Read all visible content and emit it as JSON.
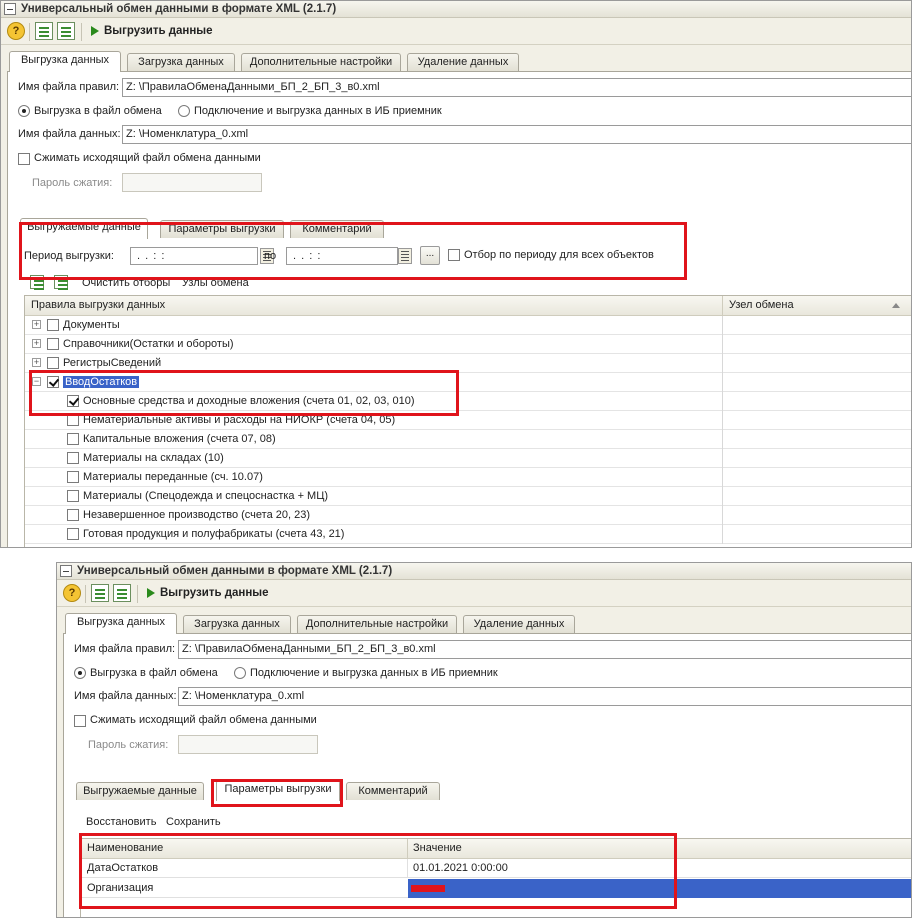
{
  "window_title": "Универсальный обмен данными в формате XML (2.1.7)",
  "toolbar": {
    "run_label": "Выгрузить данные"
  },
  "main_tabs": [
    "Выгрузка данных",
    "Загрузка данных",
    "Дополнительные настройки",
    "Удаление данных"
  ],
  "form": {
    "rules_file_label": "Имя файла правил:",
    "rules_file_value": "Z: \\ПравилаОбменаДанными_БП_2_БП_3_в0.xml",
    "radio_file": "Выгрузка в файл обмена",
    "radio_ib": "Подключение и выгрузка данных в ИБ приемник",
    "data_file_label": "Имя файла данных:",
    "data_file_value": "Z: \\Номенклатура_0.xml",
    "compress_label": "Сжимать исходящий файл обмена данными",
    "password_label": "Пароль сжатия:"
  },
  "sub_tabs": [
    "Выгружаемые данные",
    "Параметры выгрузки",
    "Комментарий"
  ],
  "period": {
    "label": "Период выгрузки:",
    "from_value": ".  .      :  :",
    "to_label": "по",
    "to_value": ".  .      :  :",
    "more_label": "...",
    "filter_all_label": "Отбор по периоду для всех объектов"
  },
  "tree_toolbar": {
    "clear_filters": "Очистить отборы",
    "nodes": "Узлы обмена"
  },
  "tree": {
    "col_rules": "Правила выгрузки данных",
    "col_node": "Узел обмена",
    "rows": [
      {
        "label": "Документы",
        "level": 0
      },
      {
        "label": "Справочники(Остатки и обороты)",
        "level": 0
      },
      {
        "label": "РегистрыСведений",
        "level": 0
      },
      {
        "label": "ВводОстатков",
        "level": 0
      },
      {
        "label": "Основные средства и доходные вложения (счета 01, 02, 03, 010)",
        "level": 1
      },
      {
        "label": "Нематериальные активы и расходы на НИОКР (счета 04, 05)",
        "level": 1
      },
      {
        "label": "Капитальные вложения (счета 07, 08)",
        "level": 1
      },
      {
        "label": "Материалы на складах (10)",
        "level": 1
      },
      {
        "label": "Материалы переданные (сч. 10.07)",
        "level": 1
      },
      {
        "label": "Материалы (Спецодежда и спецоснастка + МЦ)",
        "level": 1
      },
      {
        "label": "Незавершенное производство (счета 20, 23)",
        "level": 1
      },
      {
        "label": "Готовая продукция и полуфабрикаты (счета 43, 21)",
        "level": 1
      }
    ]
  },
  "params": {
    "restore_label": "Восстановить",
    "save_label": "Сохранить",
    "col_name": "Наименование",
    "col_value": "Значение",
    "rows": [
      {
        "name": "ДатаОстатков",
        "value": "01.01.2021 0:00:00"
      },
      {
        "name": "Организация",
        "value": ""
      }
    ]
  },
  "colors": {
    "highlight_red": "#e0141b",
    "selection_blue": "#3a63c8"
  }
}
